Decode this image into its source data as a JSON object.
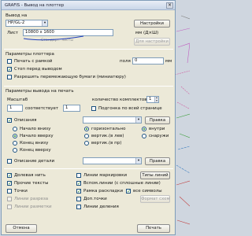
{
  "window": {
    "title": "GRAFIS - Вывод на плоттер",
    "close_glyph": "×"
  },
  "output": {
    "group_label": "Вывод на",
    "device": "HP/GL-2",
    "settings_button": "Настройки",
    "sheet_label": "Лист",
    "sheet_value": "10800 x 1600",
    "sheet_units": "мм (Д×Ш)",
    "faded_label": "Стандарт. листы",
    "for_device_button": "Для настройки"
  },
  "plotter_params": {
    "group_label": "Параметры плоттера",
    "print_frame": "Печать с рамкой",
    "fields_label": "поля",
    "fields_value": "0",
    "fields_units": "мм",
    "stop_before": "Стоп перед выводом",
    "allow_rolls": "Разрешить перемежающую бумаги (миниатюру)"
  },
  "print_params": {
    "group_label": "Параметры вывода на печать",
    "scale_label": "Масштаб",
    "copies_label": "количество комплектов",
    "copies_value": "1",
    "scale_value": "1",
    "scale_sep": "соответствует",
    "scale_value2": "1",
    "fit_page": "Подгонка по всей странице",
    "descriptions": "Описания",
    "rule_button": "Правка",
    "start_bottom": "Начало внизу",
    "start_top": "Начало вверху",
    "end_bottom": "Конец внизу",
    "end_top": "Конец вверху",
    "horizontal": "горизонтально",
    "vertical_up": "вертик.(в лев)",
    "vertical_down": "вертик.(в пр)",
    "inside": "внутри",
    "outside": "снаружи",
    "detail_desc": "Описание детали",
    "rule_button2": "Правка",
    "base_line": "Долевая нить",
    "marking_lines": "Линии маркировки",
    "line_types": "Типы линий",
    "reinforced": "Прочие тексты",
    "aux_lines": "Вспом.линии (с сплошные линии)",
    "points": "Точки",
    "frame_cut": "Рамка раскладки",
    "all_symbols": "все символы",
    "cut_lines": "Линии разреза",
    "notch_points": "Доп.точки",
    "format_button": "Формат схем",
    "seam_lines": "Линии разметки",
    "seam_points": "Линии деления"
  },
  "footer": {
    "cancel_button": "Отмена",
    "print_button": "Печать"
  },
  "icons": {
    "checkmark": "✓",
    "arrow_down": "▾",
    "arrow_up": "▴"
  }
}
